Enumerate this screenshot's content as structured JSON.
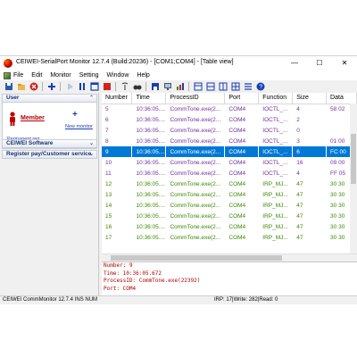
{
  "window": {
    "title": "CEIWEI-SerialPort Monitor 12.7.4  (Build:20236)  - [COM1;COM4]  - [Table view]",
    "controls": [
      "—",
      "☐",
      "✕"
    ]
  },
  "menubar": [
    "File",
    "Edit",
    "Monitor",
    "Setting",
    "Window",
    "Help"
  ],
  "toolbar": [
    "save-icon",
    "folder-open-icon",
    "stop-record-icon",
    "add-icon",
    "play-icon",
    "pause-icon",
    "window-icon",
    "record-icon",
    "antenna-icon",
    "binoculars-icon",
    "save-disk-icon",
    "monitor-icon",
    "bar-chart-icon",
    "layout-split-icon",
    "layout-horizontal-icon",
    "layout-vertical-icon",
    "layout-grid-icon",
    "list-icon",
    "help-icon"
  ],
  "leftpanel": {
    "user": {
      "header": "User",
      "member_label": "Member",
      "permanent_reg": "Permanent reg",
      "new_monitor": "New monitor"
    },
    "software_header": "CEIWEI Software",
    "register_header": "Register pay/Customer service"
  },
  "table": {
    "columns": [
      "Number",
      "Time",
      "ProcessID",
      "Port",
      "Function",
      "Size",
      "Data"
    ],
    "rows": [
      {
        "number": "5",
        "time": "10:36:05....",
        "process": "CommTone.exe(2...",
        "port": "COM4",
        "function": "IOCTL_...",
        "size": "4",
        "data": "58 02",
        "color": "#7030a0"
      },
      {
        "number": "6",
        "time": "10:36:05....",
        "process": "CommTone.exe(2...",
        "port": "COM4",
        "function": "IOCTL_...",
        "size": "2",
        "data": "",
        "color": "#7030a0"
      },
      {
        "number": "7",
        "time": "10:36:05....",
        "process": "CommTone.exe(2...",
        "port": "COM4",
        "function": "IOCTL_...",
        "size": "0",
        "data": "",
        "color": "#7030a0"
      },
      {
        "number": "8",
        "time": "10:36:05....",
        "process": "CommTone.exe(2...",
        "port": "COM4",
        "function": "IOCTL_...",
        "size": "3",
        "data": "01 00",
        "color": "#7030a0"
      },
      {
        "number": "9",
        "time": "10:36:05....",
        "process": "CommTone.exe(2...",
        "port": "COM4",
        "function": "IOCTL_...",
        "size": "6",
        "data": "FC 00",
        "color": "#ffffff",
        "selected": true
      },
      {
        "number": "10",
        "time": "10:36:05....",
        "process": "CommTone.exe(2...",
        "port": "COM4",
        "function": "IOCTL_...",
        "size": "16",
        "data": "09 00",
        "color": "#7030a0"
      },
      {
        "number": "11",
        "time": "10:36:05....",
        "process": "CommTone.exe(2...",
        "port": "COM4",
        "function": "IOCTL_...",
        "size": "4",
        "data": "FF 05",
        "color": "#7030a0"
      },
      {
        "number": "12",
        "time": "10:36:05....",
        "process": "CommTone.exe(2...",
        "port": "COM4",
        "function": "IRP_MJ...",
        "size": "47",
        "data": "30 30",
        "color": "#3a8a00"
      },
      {
        "number": "13",
        "time": "10:36:05....",
        "process": "CommTone.exe(2...",
        "port": "COM4",
        "function": "IRP_MJ...",
        "size": "47",
        "data": "30 30",
        "color": "#3a8a00"
      },
      {
        "number": "14",
        "time": "10:36:05....",
        "process": "CommTone.exe(2...",
        "port": "COM4",
        "function": "IRP_MJ...",
        "size": "47",
        "data": "30 30",
        "color": "#3a8a00"
      },
      {
        "number": "15",
        "time": "10:36:05....",
        "process": "CommTone.exe(2...",
        "port": "COM4",
        "function": "IRP_MJ...",
        "size": "47",
        "data": "30 30",
        "color": "#3a8a00"
      },
      {
        "number": "16",
        "time": "10:36:05....",
        "process": "CommTone.exe(2...",
        "port": "COM4",
        "function": "IRP_MJ...",
        "size": "47",
        "data": "30 30",
        "color": "#3a8a00"
      },
      {
        "number": "17",
        "time": "10:36:05....",
        "process": "CommTone.exe(2...",
        "port": "COM4",
        "function": "IRP_MJ...",
        "size": "47",
        "data": "30 30",
        "color": "#3a8a00"
      }
    ]
  },
  "detail": {
    "lines": [
      "Number: 9",
      "Time: 10:36:05.672",
      "ProcessID: CommTone.exe(22392)",
      "Port: COM4"
    ]
  },
  "statusbar": {
    "left": "CEIWEI CommMonitor 12.7.4   INS   NUM",
    "right": "IRP: 17|Write: 282|Read: 0"
  }
}
